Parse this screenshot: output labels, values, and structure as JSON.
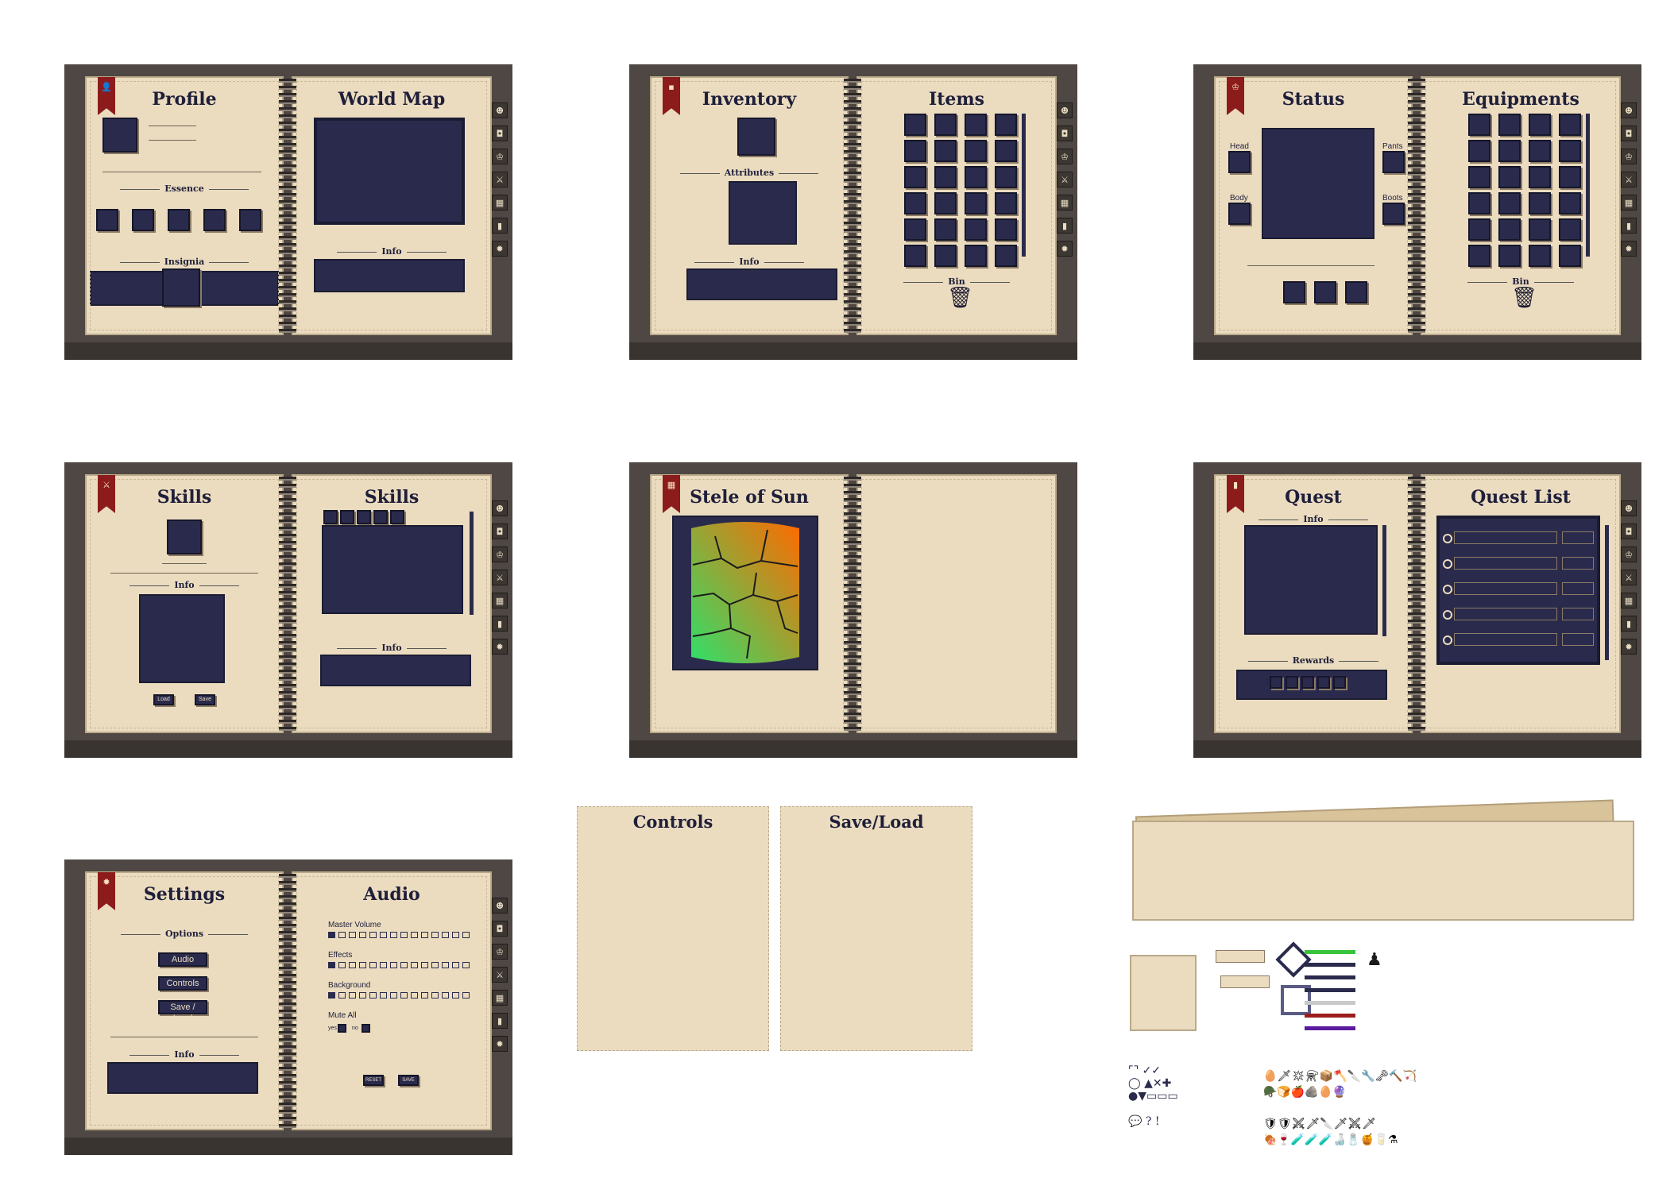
{
  "books": {
    "profile": {
      "left_title": "Profile",
      "right_title": "World Map",
      "essence": "Essence",
      "insignia": "Insignia",
      "info": "Info"
    },
    "inventory": {
      "left_title": "Inventory",
      "right_title": "Items",
      "attributes": "Attributes",
      "info": "Info",
      "bin": "Bin"
    },
    "status": {
      "left_title": "Status",
      "right_title": "Equipments",
      "head": "Head",
      "body": "Body",
      "pants": "Pants",
      "boots": "Boots",
      "bin": "Bin"
    },
    "skills": {
      "left_title": "Skills",
      "right_title": "Skills",
      "info_left": "Info",
      "info_right": "Info",
      "load": "Load",
      "save": "Save"
    },
    "stele": {
      "left_title": "Stele of Sun"
    },
    "quest": {
      "left_title": "Quest",
      "right_title": "Quest List",
      "info": "Info",
      "rewards": "Rewards"
    },
    "settings": {
      "left_title": "Settings",
      "right_title": "Audio",
      "options": "Options",
      "audio_btn": "Audio",
      "controls_btn": "Controls",
      "saveload_btn": "Save / Load",
      "info": "Info",
      "master_volume": "Master Volume",
      "effects": "Effects",
      "background": "Background",
      "mute_all": "Mute All",
      "yes": "yes",
      "no": "no",
      "reset": "RESET",
      "save": "SAVE"
    }
  },
  "sheets": {
    "controls": "Controls",
    "save_load": "Save/Load"
  },
  "volume": {
    "master": 0.1,
    "effects": 0.1,
    "background": 0.1
  },
  "colors": {
    "page": "#ebdcc0",
    "slot": "#2a2b4c",
    "ribbon": "#8c1c1c",
    "frame": "#4f4743"
  },
  "tab_icons": [
    "profile-icon",
    "bag-icon",
    "helmet-icon",
    "sword-icon",
    "map-icon",
    "book-icon",
    "gear-icon"
  ]
}
